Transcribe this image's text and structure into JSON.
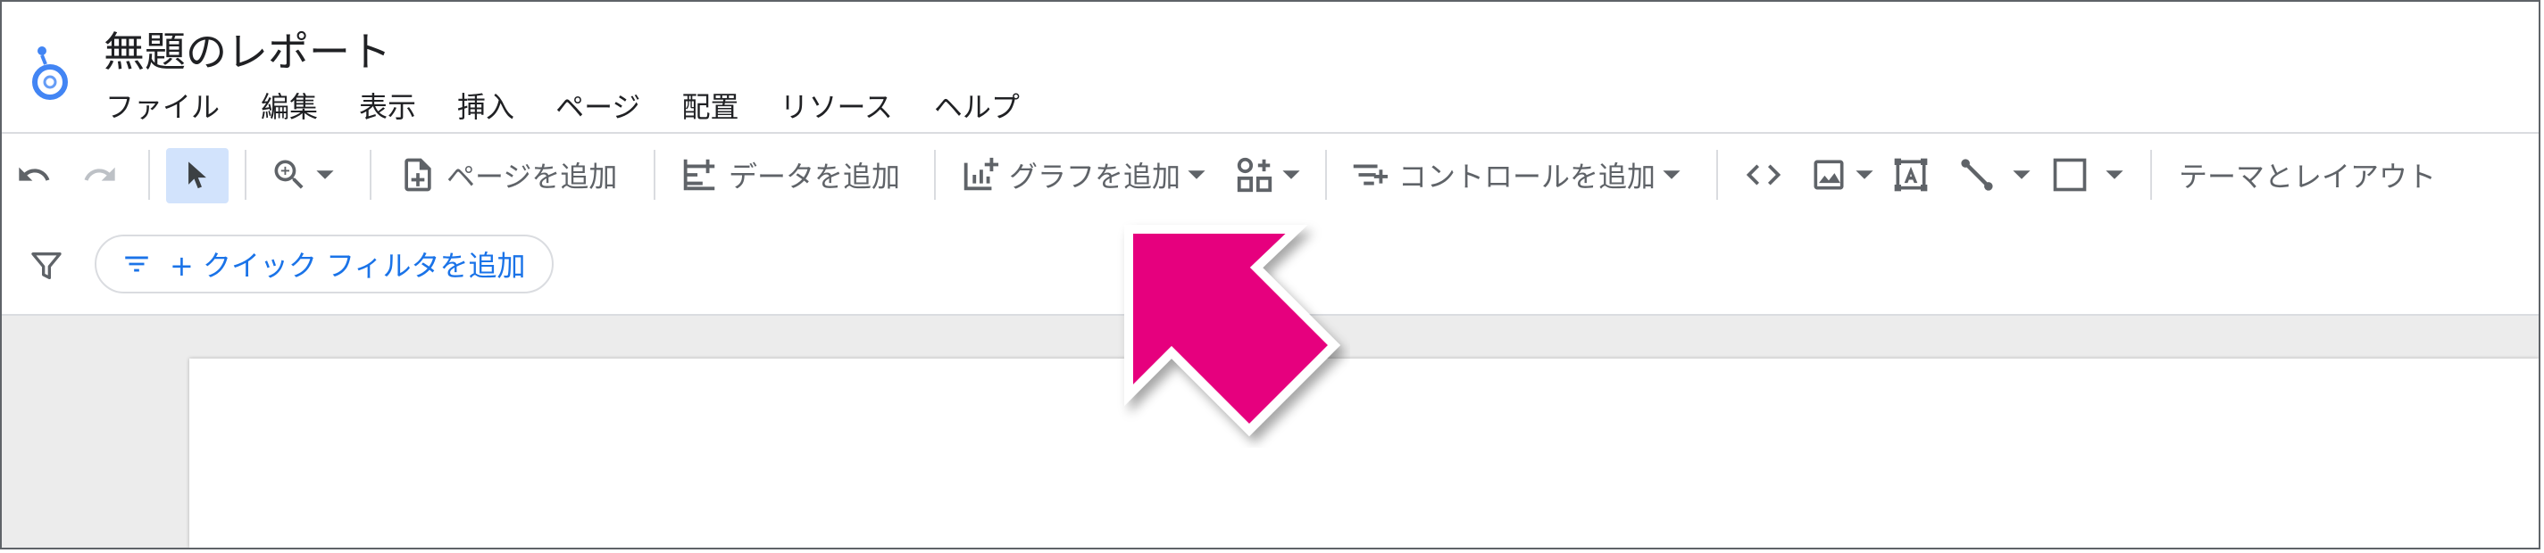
{
  "header": {
    "title": "無題のレポート",
    "menu": [
      "ファイル",
      "編集",
      "表示",
      "挿入",
      "ページ",
      "配置",
      "リソース",
      "ヘルプ"
    ]
  },
  "toolbar": {
    "add_page": "ページを追加",
    "add_data": "データを追加",
    "add_chart": "グラフを追加",
    "add_control": "コントロールを追加",
    "theme_layout": "テーマとレイアウト",
    "code_glyph": "<>"
  },
  "filterbar": {
    "quick_filter": "+ クイック フィルタを追加"
  },
  "colors": {
    "accent_blue": "#1a73e8",
    "selected_bg": "#d2e3fc",
    "arrow": "#e6007e",
    "canvas_bg": "#ececec"
  }
}
